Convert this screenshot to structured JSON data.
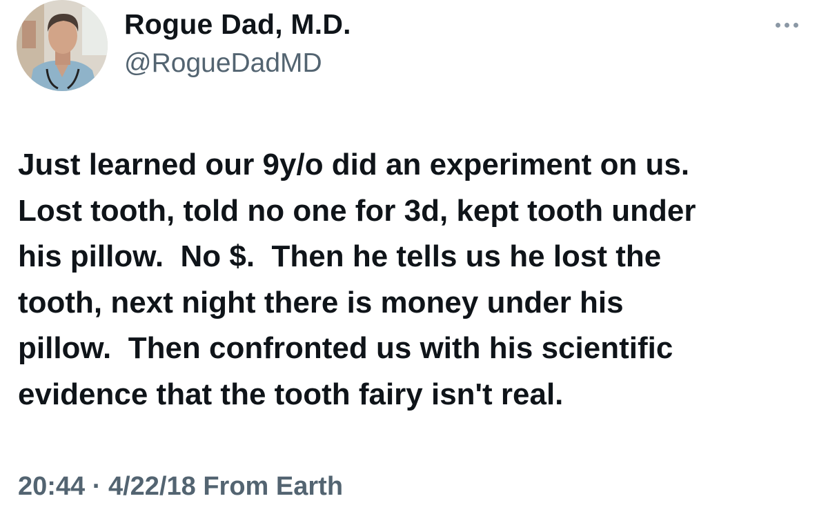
{
  "tweet": {
    "author": {
      "display_name": "Rogue Dad, M.D.",
      "handle": "@RogueDadMD",
      "avatar_icon": "profile-photo"
    },
    "more_icon": "ellipsis-icon",
    "text_lines": [
      "Just learned our 9y/o did an experiment on us.",
      "Lost tooth, told no one for 3d, kept tooth under",
      "his pillow.  No $.  Then he tells us he lost the",
      "tooth, next night there is money under his",
      "pillow.  Then confronted us with his scientific",
      "evidence that the tooth fairy isn't real."
    ],
    "time": "20:44",
    "separator": "·",
    "date": "4/22/18",
    "source": "From Earth"
  },
  "colors": {
    "text_primary": "#0f1419",
    "text_secondary": "#536471",
    "icon_muted": "#8b98a5",
    "background": "#ffffff"
  }
}
